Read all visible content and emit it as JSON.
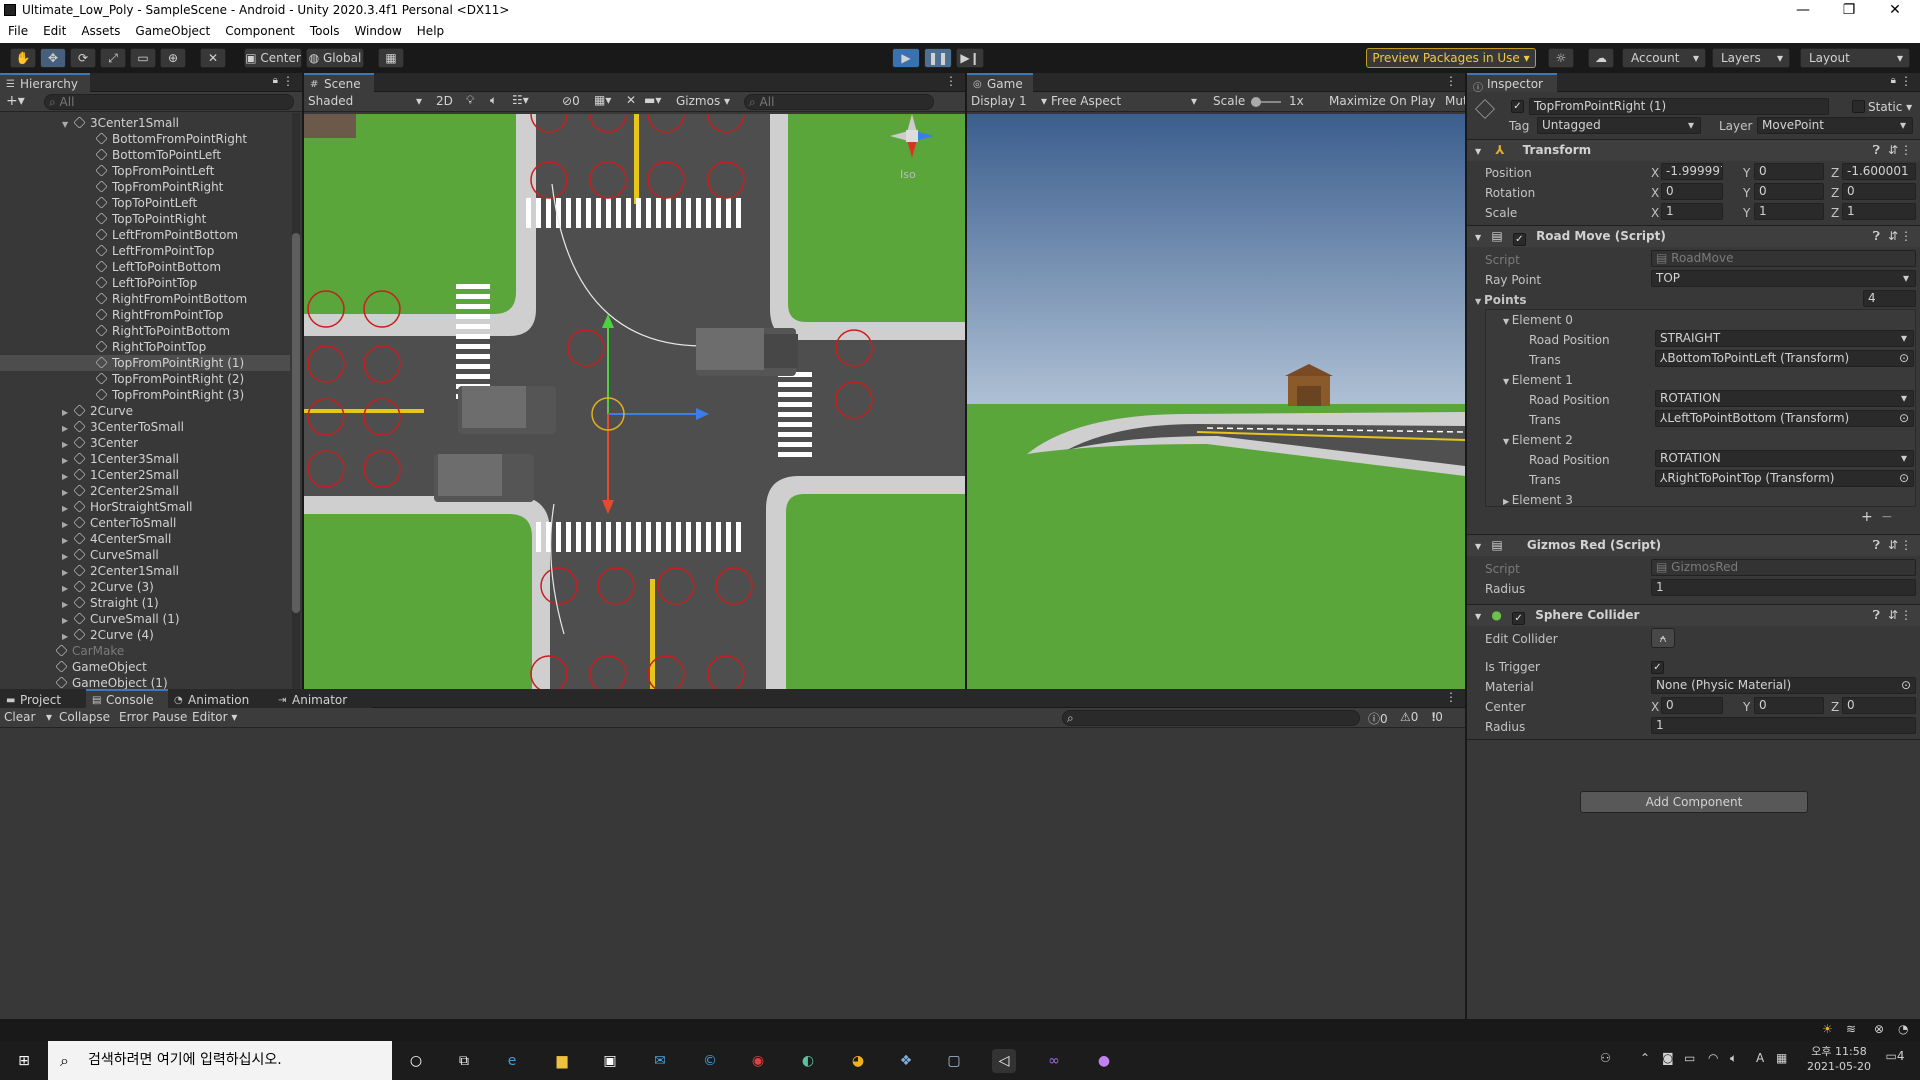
{
  "window": {
    "title": "Ultimate_Low_Poly - SampleScene - Android - Unity 2020.3.4f1 Personal <DX11>"
  },
  "menu": [
    "File",
    "Edit",
    "Assets",
    "GameObject",
    "Component",
    "Tools",
    "Window",
    "Help"
  ],
  "toolbar": {
    "center": "Center",
    "global": "Global",
    "preview": "Preview Packages in Use",
    "account": "Account",
    "layers": "Layers",
    "layout": "Layout"
  },
  "hierarchy": {
    "title": "Hierarchy",
    "search": "All",
    "items": [
      {
        "label": "3Center1Small",
        "depth": 0,
        "fold": "open"
      },
      {
        "label": "BottomFromPointRight",
        "depth": 1
      },
      {
        "label": "BottomToPointLeft",
        "depth": 1
      },
      {
        "label": "TopFromPointLeft",
        "depth": 1
      },
      {
        "label": "TopFromPointRight",
        "depth": 1
      },
      {
        "label": "TopToPointLeft",
        "depth": 1
      },
      {
        "label": "TopToPointRight",
        "depth": 1
      },
      {
        "label": "LeftFromPointBottom",
        "depth": 1
      },
      {
        "label": "LeftFromPointTop",
        "depth": 1
      },
      {
        "label": "LeftToPointBottom",
        "depth": 1
      },
      {
        "label": "LeftToPointTop",
        "depth": 1
      },
      {
        "label": "RightFromPointBottom",
        "depth": 1
      },
      {
        "label": "RightFromPointTop",
        "depth": 1
      },
      {
        "label": "RightToPointBottom",
        "depth": 1
      },
      {
        "label": "RightToPointTop",
        "depth": 1
      },
      {
        "label": "TopFromPointRight (1)",
        "depth": 1,
        "selected": true
      },
      {
        "label": "TopFromPointRight (2)",
        "depth": 1
      },
      {
        "label": "TopFromPointRight (3)",
        "depth": 1
      },
      {
        "label": "2Curve",
        "depth": 0,
        "fold": "closed"
      },
      {
        "label": "3CenterToSmall",
        "depth": 0,
        "fold": "closed"
      },
      {
        "label": "3Center",
        "depth": 0,
        "fold": "closed"
      },
      {
        "label": "1Center3Small",
        "depth": 0,
        "fold": "closed"
      },
      {
        "label": "1Center2Small",
        "depth": 0,
        "fold": "closed"
      },
      {
        "label": "2Center2Small",
        "depth": 0,
        "fold": "closed"
      },
      {
        "label": "HorStraightSmall",
        "depth": 0,
        "fold": "closed"
      },
      {
        "label": "CenterToSmall",
        "depth": 0,
        "fold": "closed"
      },
      {
        "label": "4CenterSmall",
        "depth": 0,
        "fold": "closed"
      },
      {
        "label": "CurveSmall",
        "depth": 0,
        "fold": "closed"
      },
      {
        "label": "2Center1Small",
        "depth": 0,
        "fold": "closed"
      },
      {
        "label": "2Curve (3)",
        "depth": 0,
        "fold": "closed"
      },
      {
        "label": "Straight (1)",
        "depth": 0,
        "fold": "closed"
      },
      {
        "label": "CurveSmall (1)",
        "depth": 0,
        "fold": "closed"
      },
      {
        "label": "2Curve (4)",
        "depth": 0,
        "fold": "closed"
      },
      {
        "label": "CarMake",
        "depth": -1,
        "dim": true
      },
      {
        "label": "GameObject",
        "depth": -1
      },
      {
        "label": "GameObject (1)",
        "depth": -1
      }
    ]
  },
  "scene": {
    "title": "Scene",
    "shading": "Shaded",
    "mode2d": "2D",
    "fx_count": "0",
    "gizmos": "Gizmos",
    "search": "All",
    "iso": "Iso"
  },
  "game": {
    "title": "Game",
    "display": "Display 1",
    "aspect": "Free Aspect",
    "scale_label": "Scale",
    "scale_value": "1x",
    "maximize": "Maximize On Play",
    "mute": "Mut"
  },
  "inspector": {
    "title": "Inspector",
    "object_name": "TopFromPointRight (1)",
    "static": "Static",
    "tag_label": "Tag",
    "tag": "Untagged",
    "layer_label": "Layer",
    "layer": "MovePoint",
    "transform": {
      "title": "Transform",
      "position": {
        "label": "Position",
        "x": "-1.999997",
        "y": "0",
        "z": "-1.600001"
      },
      "rotation": {
        "label": "Rotation",
        "x": "0",
        "y": "0",
        "z": "0"
      },
      "scale": {
        "label": "Scale",
        "x": "1",
        "y": "1",
        "z": "1"
      }
    },
    "roadmove": {
      "title": "Road Move (Script)",
      "script_label": "Script",
      "script": "RoadMove",
      "ray_label": "Ray Point",
      "ray": "TOP",
      "points_label": "Points",
      "points_count": "4",
      "elements": [
        {
          "name": "Element 0",
          "pos_label": "Road Position",
          "pos": "STRAIGHT",
          "trans_label": "Trans",
          "trans": "BottomToPointLeft (Transform)"
        },
        {
          "name": "Element 1",
          "pos_label": "Road Position",
          "pos": "ROTATION",
          "trans_label": "Trans",
          "trans": "LeftToPointBottom (Transform)"
        },
        {
          "name": "Element 2",
          "pos_label": "Road Position",
          "pos": "ROTATION",
          "trans_label": "Trans",
          "trans": "RightToPointTop (Transform)"
        },
        {
          "name": "Element 3"
        }
      ]
    },
    "gizmosred": {
      "title": "Gizmos Red (Script)",
      "script_label": "Script",
      "script": "GizmosRed",
      "radius_label": "Radius",
      "radius": "1"
    },
    "sphere": {
      "title": "Sphere Collider",
      "edit_label": "Edit Collider",
      "trigger_label": "Is Trigger",
      "material_label": "Material",
      "material": "None (Physic Material)",
      "center_label": "Center",
      "cx": "0",
      "cy": "0",
      "cz": "0",
      "radius_label": "Radius",
      "radius": "1"
    },
    "add_component": "Add Component"
  },
  "bottom": {
    "tabs": [
      "Project",
      "Console",
      "Animation",
      "Animator"
    ],
    "clear": "Clear",
    "collapse": "Collapse",
    "error_pause": "Error Pause",
    "editor": "Editor",
    "log": "0",
    "warn": "0",
    "err": "0"
  },
  "taskbar": {
    "search_placeholder": "검색하려면 여기에 입력하십시오.",
    "time": "오후 11:58",
    "date": "2021-05-20",
    "ime": "A",
    "notify": "4"
  }
}
